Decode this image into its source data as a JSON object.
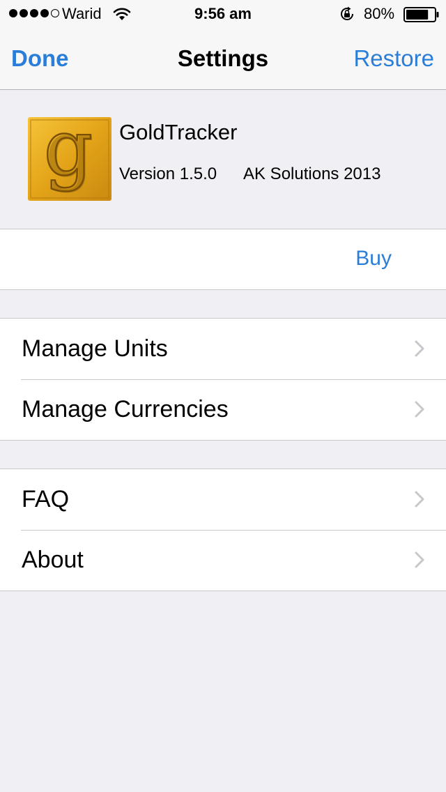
{
  "status_bar": {
    "carrier": "Warid",
    "time": "9:56 am",
    "battery_percent": "80%",
    "battery_level": 0.8,
    "signal_bars_filled": 4,
    "signal_bars_total": 5
  },
  "nav": {
    "done_label": "Done",
    "title": "Settings",
    "restore_label": "Restore"
  },
  "app_info": {
    "name": "GoldTracker",
    "version": "Version 1.5.0",
    "company": "AK Solutions 2013",
    "icon": "goldtracker-g-logo"
  },
  "purchase": {
    "buy_label": "Buy"
  },
  "manage": {
    "units_label": "Manage Units",
    "currencies_label": "Manage Currencies"
  },
  "info": {
    "faq_label": "FAQ",
    "about_label": "About"
  },
  "colors": {
    "accent": "#2a7ed8",
    "background": "#efeff4",
    "separator": "#c8c7cc",
    "chevron": "#c7c7cc"
  }
}
